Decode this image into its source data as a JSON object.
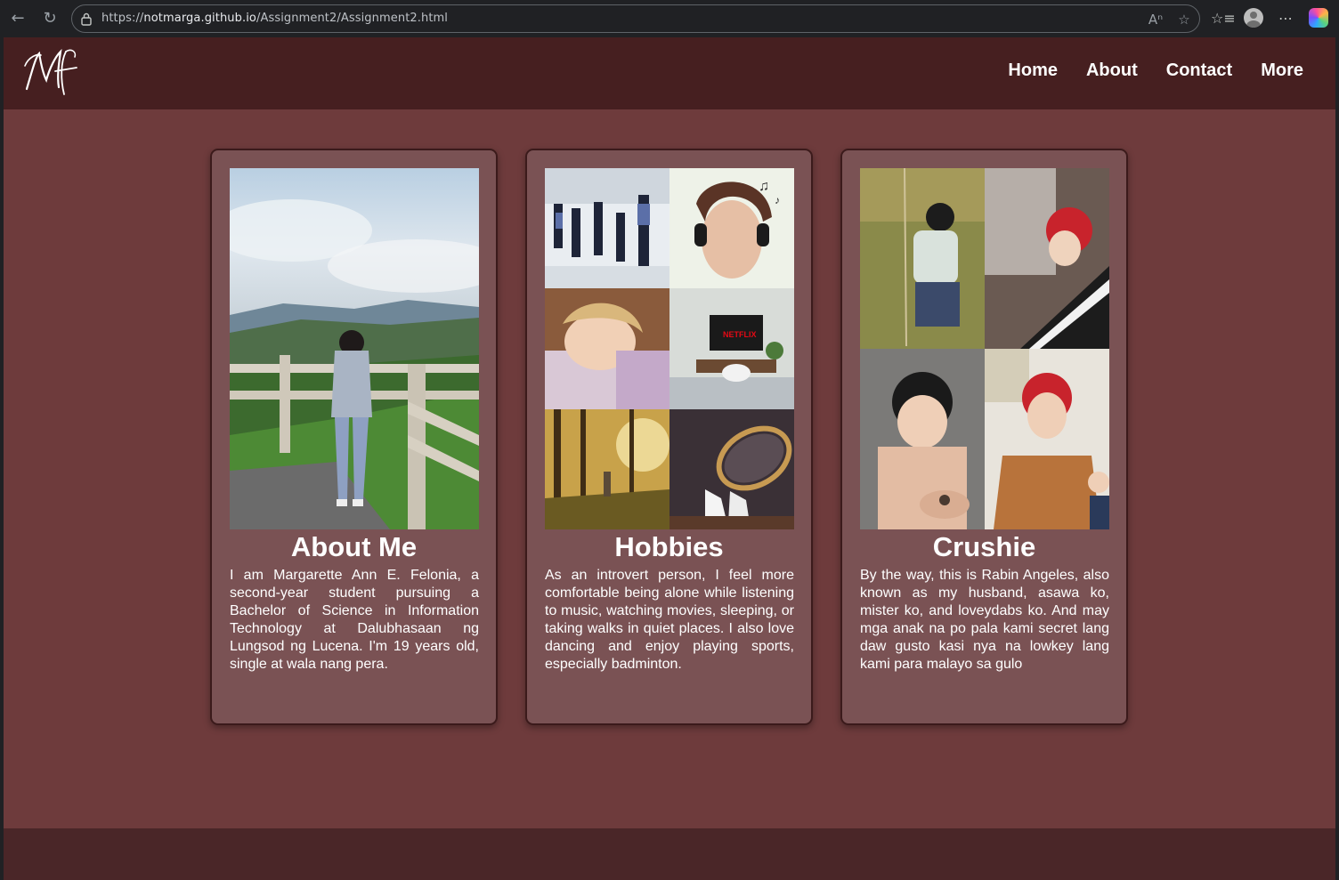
{
  "browser": {
    "url_prefix": "https://",
    "url_host": "notmarga.github.io",
    "url_path": "/Assignment2/Assignment2.html"
  },
  "site": {
    "logo_text": "Mf",
    "nav": [
      "Home",
      "About",
      "Contact",
      "More"
    ]
  },
  "cards": [
    {
      "title": "About Me",
      "image": "photo of a girl in a gray hoodie standing by a wooden fence on a hill overlooking a valley",
      "text": "I am Margarette Ann E. Felonia, a second-year student pursuing a Bachelor of Science in Information Technology at Dalubhasaan ng Lungsod ng Lucena. I'm 19 years old, single at wala nang pera."
    },
    {
      "title": "Hobbies",
      "images": [
        "dance class",
        "woman with headphones listening to music",
        "child sleeping",
        "tv with netflix",
        "person walking in forest",
        "badminton racket and shuttlecocks"
      ],
      "text": "As an introvert person, I feel more comfortable being alone while listening to music, watching movies, sleeping, or taking walks in quiet places. I also love dancing and enjoy playing sports, especially badminton."
    },
    {
      "title": "Crushie",
      "images": [
        "man on rope swing",
        "red-haired man at piano",
        "man in hot spring",
        "red-haired man in brown shirt"
      ],
      "text": "By the way, this is Rabin Angeles, also known as my husband, asawa ko, mister ko, and loveydabs ko. And may mga anak na po pala kami secret lang daw gusto kasi nya na lowkey lang kami para malayo sa gulo"
    }
  ],
  "colors": {
    "page_bg": "#6e3b3c",
    "header_bg": "#461f20",
    "card_bg": "#7a5254",
    "footer_bg": "#4a2628"
  }
}
